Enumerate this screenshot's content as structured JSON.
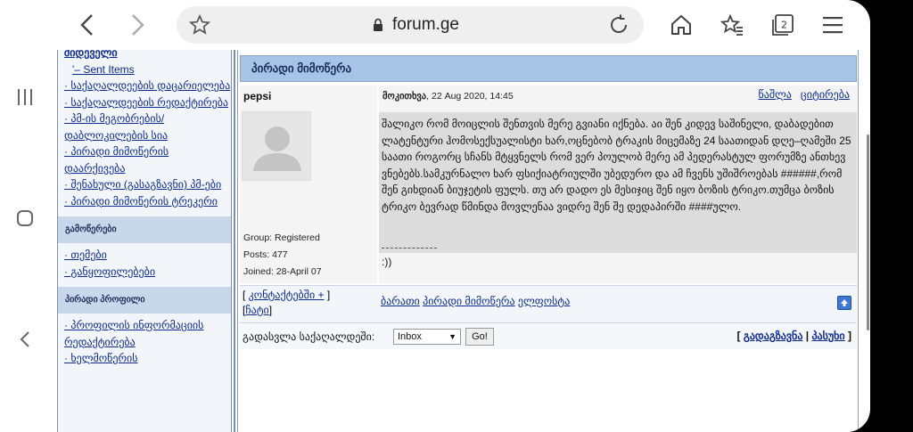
{
  "browser": {
    "url": "forum.ge",
    "tab_count": "2"
  },
  "sidebar": {
    "top_items": [
      {
        "label": "შიდეველი",
        "prefix": ""
      },
      {
        "label": "Sent Items",
        "prefix": "'– "
      },
      {
        "label": "საქაღალდეების დაცარიელება",
        "prefix": "· "
      },
      {
        "label": "საქაღალდეების რედაქტირება",
        "prefix": "· "
      },
      {
        "label": "პმ-ის მეგობრების/ დაბლოკილების სია",
        "prefix": "· "
      },
      {
        "label": "პირადი მიმოწერის დაარქივება",
        "prefix": "· "
      },
      {
        "label": "შენახული (გასაგზავნი) პმ-ები",
        "prefix": "· "
      },
      {
        "label": "პირადი მიმოწერის ტრეკერი",
        "prefix": "· "
      }
    ],
    "section_notifications": "გამოწერები",
    "notification_items": [
      {
        "label": "თემები",
        "prefix": "· "
      },
      {
        "label": "განყოფილებები",
        "prefix": "· "
      }
    ],
    "section_profile": "პირადი პროფილი",
    "profile_items": [
      {
        "label": "პროფილის ინფორმაციის რედაქტირება",
        "prefix": "· "
      },
      {
        "label": "ხელმოწერის",
        "prefix": "· "
      }
    ]
  },
  "main": {
    "title": "პირადი მიმოწერა",
    "post": {
      "author": "pepsi",
      "group": "Group: Registered",
      "posts": "Posts: 477",
      "joined": "Joined: 28-April 07",
      "sent_label": "მოკითხვა",
      "sent_date": ", 22 Aug 2020, 14:45",
      "delete_label": "წაშლა",
      "quote_label": "ციტირება",
      "body": "შალიკო რომ მოიცლის შენთვის მერე გვიანი იქნება. აი შენ კიდევ საშინელი, დაბადებით ლატენტური ჰომოსექსუალისტი ხარ,ოცნებობ ტრაკის მიცემაზე 24 საათიდან დღე–ღამეში 25 საათი როგორც სჩანს მტყვნელს რომ ვერ პოულობ მერე ამ პედერასტულ ფორუმზე ანთხევ ვნებებს.სამკურნალო ხარ ფსიქიატრიულში უბედურო და ამ ჩვენს უშიშროებას ######,რომ შენ გიხდიან ბიუჯეტის ფულს. თუ არ დადო ეს მესიჯიც შენ იყო ბოზის ტრიკო.თუმცა ბოზის ტრიკო ბევრად წმინდა მოვლენაა ვიდრე შენ შე დედაპირში ####ულო.",
      "signature": ":))"
    },
    "contacts_label": "კონტაქტებში +",
    "chat_label": "ჩატი",
    "bottom_links": [
      "ბარათი",
      "პირადი მიმოწერა",
      "ელფოსტა"
    ],
    "goto_label": "გადასვლა საქაღალდეში:",
    "folder_selected": "Inbox",
    "go_label": "Go!",
    "forward_label": "გადაგზავნა",
    "reply_label": "პასუხი"
  },
  "colors": {
    "title_bar": "#a6c4e6",
    "link": "#0b2a93",
    "post_body_bg": "#dcdcdc"
  }
}
